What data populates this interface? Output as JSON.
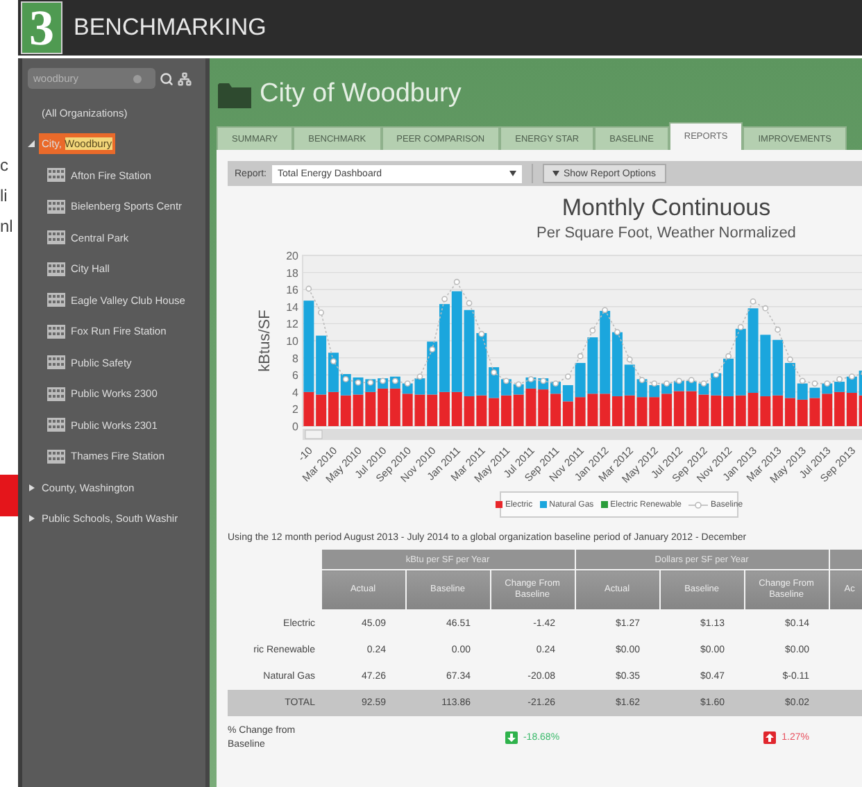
{
  "background_fragments": {
    "texts": [
      "c",
      "li",
      "nl"
    ]
  },
  "header": {
    "logo": "3",
    "title": "BENCHMARKING"
  },
  "sidebar": {
    "search": {
      "value": "woodbury"
    },
    "tree": [
      {
        "label_parts": [
          {
            "text": "(All Organizations)",
            "highlight": false
          }
        ],
        "selected": false
      },
      {
        "label_parts": [
          {
            "text": "City, ",
            "highlight": false
          },
          {
            "text": "Woodbury",
            "highlight": true
          }
        ],
        "selected": true,
        "expanded": true,
        "children": [
          {
            "label_parts": [
              {
                "text": "Afton Fire Station",
                "highlight": false
              }
            ],
            "selected": false
          },
          {
            "label_parts": [
              {
                "text": "Bielenberg Sports Centr",
                "highlight": false
              }
            ],
            "selected": false
          },
          {
            "label_parts": [
              {
                "text": "Central Park",
                "highlight": false
              }
            ],
            "selected": false
          },
          {
            "label_parts": [
              {
                "text": "City Hall",
                "highlight": false
              }
            ],
            "selected": false
          },
          {
            "label_parts": [
              {
                "text": "Eagle Valley Club House",
                "highlight": false
              }
            ],
            "selected": false
          },
          {
            "label_parts": [
              {
                "text": "Fox Run Fire Station",
                "highlight": false
              }
            ],
            "selected": false
          },
          {
            "label_parts": [
              {
                "text": "Public Safety",
                "highlight": false
              }
            ],
            "selected": false
          },
          {
            "label_parts": [
              {
                "text": "Public Works 2300",
                "highlight": false
              }
            ],
            "selected": false
          },
          {
            "label_parts": [
              {
                "text": "Public Works 2301",
                "highlight": false
              }
            ],
            "selected": false
          },
          {
            "label_parts": [
              {
                "text": "Thames Fire Station",
                "highlight": false
              }
            ],
            "selected": false
          }
        ]
      },
      {
        "label_parts": [
          {
            "text": "County, Washington",
            "highlight": false
          }
        ],
        "selected": false,
        "expanded": false
      },
      {
        "label_parts": [
          {
            "text": "Public Schools, South Washir",
            "highlight": false
          }
        ],
        "selected": false,
        "expanded": false
      }
    ]
  },
  "main": {
    "title": "City of Woodbury",
    "tabs": [
      {
        "label": "SUMMARY",
        "selected": false
      },
      {
        "label": "BENCHMARK",
        "selected": false
      },
      {
        "label": "PEER COMPARISON",
        "selected": false
      },
      {
        "label": "ENERGY STAR",
        "selected": false
      },
      {
        "label": "BASELINE",
        "selected": false
      },
      {
        "label": "REPORTS",
        "selected": true
      },
      {
        "label": "IMPROVEMENTS",
        "selected": false
      }
    ],
    "report_bar": {
      "label": "Report:",
      "report": "Total Energy Dashboard",
      "options_button": "Show Report Options"
    }
  },
  "chart": {
    "chart_data": {
      "type": "bar",
      "stacked": true,
      "grid": true,
      "title": "Monthly Continuous",
      "subtitle": "Per Square Foot, Weather Normalized",
      "ylabel": "kBtus/SF",
      "ylim": [
        0,
        20
      ],
      "yticks": [
        0,
        2,
        4,
        6,
        8,
        10,
        12,
        14,
        16,
        18,
        20
      ],
      "categories": [
        "-10",
        null,
        "Mar 2010",
        null,
        "May 2010",
        null,
        "Jul 2010",
        null,
        "Sep 2010",
        null,
        "Nov 2010",
        null,
        "Jan 2011",
        null,
        "Mar 2011",
        null,
        "May 2011",
        null,
        "Jul 2011",
        null,
        "Sep 2011",
        null,
        "Nov 2011",
        null,
        "Jan 2012",
        null,
        "Mar 2012",
        null,
        "May 2012",
        null,
        "Jul 2012",
        null,
        "Sep 2012",
        null,
        "Nov 2012",
        null,
        "Jan 2013",
        null,
        "Mar 2013",
        null,
        "May 2013",
        null,
        "Jul 2013",
        null,
        "Sep 2013",
        null
      ],
      "series": [
        {
          "name": "Electric",
          "color": "#e8262a",
          "values": [
            4.0,
            3.7,
            4.0,
            3.6,
            3.7,
            4.0,
            4.4,
            4.4,
            3.8,
            3.7,
            3.7,
            4.0,
            4.0,
            3.5,
            3.6,
            3.3,
            3.6,
            3.7,
            4.4,
            4.3,
            3.8,
            2.9,
            3.4,
            3.8,
            3.8,
            3.5,
            3.6,
            3.4,
            3.4,
            3.8,
            4.1,
            4.1,
            3.7,
            3.6,
            3.5,
            3.6,
            3.9,
            3.5,
            3.6,
            3.3,
            3.1,
            3.3,
            3.8,
            4.0,
            3.9,
            3.6
          ]
        },
        {
          "name": "Natural Gas",
          "color": "#1ba6dd",
          "values": [
            10.7,
            6.9,
            4.6,
            2.5,
            2.0,
            1.5,
            1.2,
            1.4,
            1.2,
            1.9,
            6.2,
            10.3,
            11.8,
            10.1,
            7.3,
            3.6,
            1.9,
            1.2,
            1.3,
            1.3,
            1.4,
            1.9,
            4.0,
            6.6,
            9.7,
            7.5,
            3.6,
            2.1,
            1.4,
            1.2,
            1.2,
            1.2,
            1.3,
            2.6,
            4.4,
            7.8,
            9.9,
            7.2,
            6.5,
            4.1,
            1.9,
            1.2,
            1.2,
            1.2,
            1.9,
            2.9
          ]
        },
        {
          "name": "Electric Renewable",
          "color": "#2a9d3a",
          "values": [
            0,
            0,
            0,
            0,
            0,
            0,
            0,
            0,
            0,
            0,
            0,
            0,
            0,
            0,
            0,
            0,
            0,
            0,
            0,
            0,
            0,
            0,
            0,
            0,
            0,
            0,
            0,
            0,
            0,
            0,
            0,
            0,
            0,
            0,
            0,
            0,
            0,
            0,
            0,
            0,
            0,
            0,
            0,
            0,
            0,
            0
          ]
        },
        {
          "name": "Baseline",
          "type": "line",
          "line_style": "dashed",
          "color": "#bbbbbb",
          "values": [
            16.1,
            13.3,
            7.6,
            5.5,
            5.1,
            5.1,
            5.3,
            5.3,
            5.0,
            5.8,
            9.0,
            14.9,
            16.9,
            14.4,
            10.8,
            6.3,
            5.3,
            4.9,
            5.5,
            5.3,
            5.0,
            5.8,
            8.2,
            11.2,
            13.6,
            11.0,
            7.8,
            5.4,
            5.0,
            5.0,
            5.3,
            5.4,
            5.0,
            6.0,
            8.2,
            11.6,
            14.6,
            13.8,
            11.3,
            7.8,
            5.3,
            5.0,
            5.0,
            5.5,
            5.8,
            6.2
          ]
        }
      ]
    }
  },
  "table": {
    "caption": "Using the 12 month period August 2013 - July 2014 to a global organization baseline period of January 2012 - December",
    "groups": [
      {
        "label": "kBtu per SF per Year",
        "columns": [
          "Actual",
          "Baseline",
          "Change From Baseline"
        ]
      },
      {
        "label": "Dollars per SF per Year",
        "columns": [
          "Actual",
          "Baseline",
          "Change From Baseline"
        ]
      },
      {
        "columns": [
          "Ac"
        ]
      }
    ],
    "rows": [
      {
        "label": "Electric",
        "kind": "normal",
        "cells": [
          "45.09",
          "46.51",
          "-1.42",
          "$1.27",
          "$1.13",
          "$0.14"
        ]
      },
      {
        "label": "ric Renewable",
        "kind": "normal",
        "cells": [
          "0.24",
          "0.00",
          "0.24",
          "$0.00",
          "$0.00",
          "$0.00"
        ]
      },
      {
        "label": "Natural Gas",
        "kind": "normal",
        "cells": [
          "47.26",
          "67.34",
          "-20.08",
          "$0.35",
          "$0.47",
          "$-0.11"
        ]
      },
      {
        "label": "TOTAL",
        "kind": "total",
        "cells": [
          "92.59",
          "113.86",
          "-21.26",
          "$1.62",
          "$1.60",
          "$0.02"
        ]
      }
    ],
    "change_row": {
      "label": "% Change from Baseline",
      "changes": [
        {
          "text": "-18.68%",
          "kind": "decrease"
        },
        {
          "text": "1.27%",
          "kind": "increase"
        }
      ]
    }
  }
}
